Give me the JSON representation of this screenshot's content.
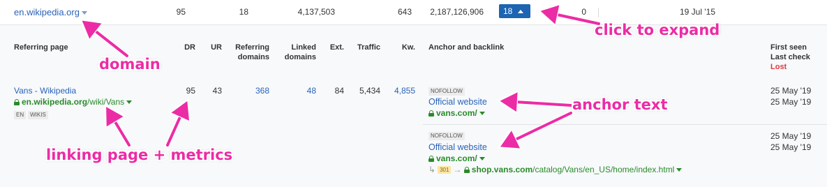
{
  "domain_row": {
    "domain": "en.wikipedia.org",
    "dr": "95",
    "ur": "18",
    "referring_domains": "4,137,503",
    "linked_domains": "643",
    "traffic": "2,187,126,906",
    "expand_count": "18",
    "ext": "0",
    "first_seen": "19 Jul '15"
  },
  "headers": {
    "referring_page": "Referring page",
    "dr": "DR",
    "ur": "UR",
    "referring_domains_1": "Referring",
    "referring_domains_2": "domains",
    "linked_domains_1": "Linked",
    "linked_domains_2": "domains",
    "ext": "Ext.",
    "traffic": "Traffic",
    "kw": "Kw.",
    "anchor": "Anchor and backlink",
    "first_seen": "First seen",
    "last_check": "Last check",
    "lost": "Lost"
  },
  "referring": {
    "title": "Vans - Wikipedia",
    "url_domain": "en.wikipedia.org",
    "url_path": "/wiki/Vans",
    "tags": [
      "EN",
      "WIKIS"
    ],
    "dr": "95",
    "ur": "43",
    "referring_domains": "368",
    "linked_domains": "48",
    "ext": "84",
    "traffic": "5,434",
    "kw": "4,855"
  },
  "backlinks": [
    {
      "tag": "NOFOLLOW",
      "anchor": "Official website",
      "target": "vans.com/",
      "first_seen": "25 May '19",
      "last_check": "25 May '19"
    },
    {
      "tag": "NOFOLLOW",
      "anchor": "Official website",
      "target": "vans.com/",
      "redirect_code": "301",
      "redirect_domain": "shop.vans.com",
      "redirect_path": "/catalog/Vans/en_US/home/index.html",
      "first_seen": "25 May '19",
      "last_check": "25 May '19"
    }
  ],
  "annotations": {
    "domain": "domain",
    "click_to_expand": "click to expand",
    "anchor_text": "anchor text",
    "linking_page": "linking page + metrics"
  },
  "colors": {
    "accent_link": "#2a63b8",
    "green_url": "#2a8a2a",
    "badge_blue": "#1d64b2",
    "lost_red": "#e0393e",
    "annotation_pink": "#ec2ca5"
  }
}
